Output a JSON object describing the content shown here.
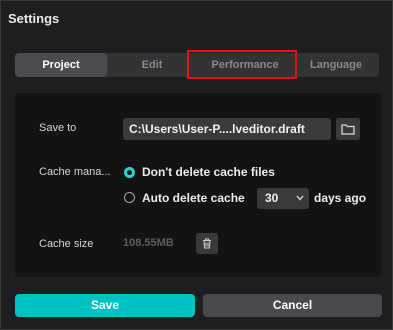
{
  "dialog": {
    "title": "Settings"
  },
  "tabs": [
    {
      "label": "Project",
      "active": true
    },
    {
      "label": "Edit",
      "active": false
    },
    {
      "label": "Performance",
      "active": false
    },
    {
      "label": "Language",
      "active": false
    }
  ],
  "project": {
    "save_to": {
      "label": "Save to",
      "path": "C:\\Users\\User-P....lveditor.draft",
      "icon": "folder-icon"
    },
    "cache_management": {
      "label": "Cache mana...",
      "options": [
        {
          "label": "Don't delete cache files",
          "selected": true
        },
        {
          "label": "Auto delete cache",
          "selected": false
        }
      ],
      "days_value": "30",
      "days_suffix": "days ago"
    },
    "cache_size": {
      "label": "Cache size",
      "value": "108.55MB",
      "icon": "trash-icon"
    }
  },
  "footer": {
    "save_label": "Save",
    "cancel_label": "Cancel"
  },
  "colors": {
    "accent": "#00c2c2",
    "highlight": "#e01515"
  }
}
